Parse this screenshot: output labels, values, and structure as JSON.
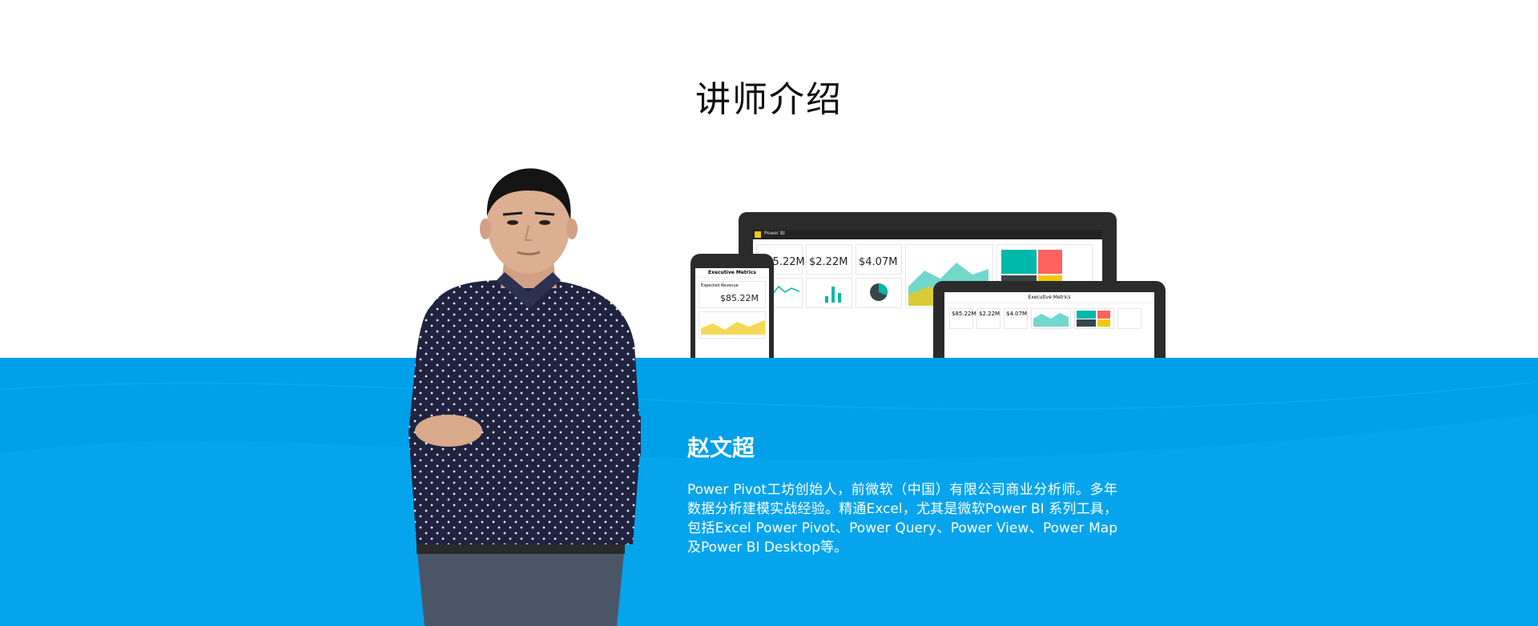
{
  "section_title": "讲师介绍",
  "instructor": {
    "name": "赵文超",
    "bio": "Power Pivot工坊创始人，前微软（中国）有限公司商业分析师。多年数据分析建模实战经验。精通Excel，尤其是微软Power BI 系列工具，包括Excel Power Pivot、Power Query、Power View、Power Map及Power BI Desktop等。"
  },
  "laptop": {
    "app_name": "Power BI",
    "kpis": [
      "$85.22M",
      "$2.22M",
      "$4.07M"
    ]
  },
  "tablet": {
    "title": "Executive Metrics",
    "kpis": [
      "$85.22M",
      "$2.22M",
      "$4.07M"
    ]
  },
  "phone": {
    "title": "Executive Metrics",
    "kpi_label": "Expected Revenue",
    "kpi_value": "$85.22M"
  },
  "colors": {
    "band": "#00a0e9",
    "text_on_band": "#ffffff"
  }
}
